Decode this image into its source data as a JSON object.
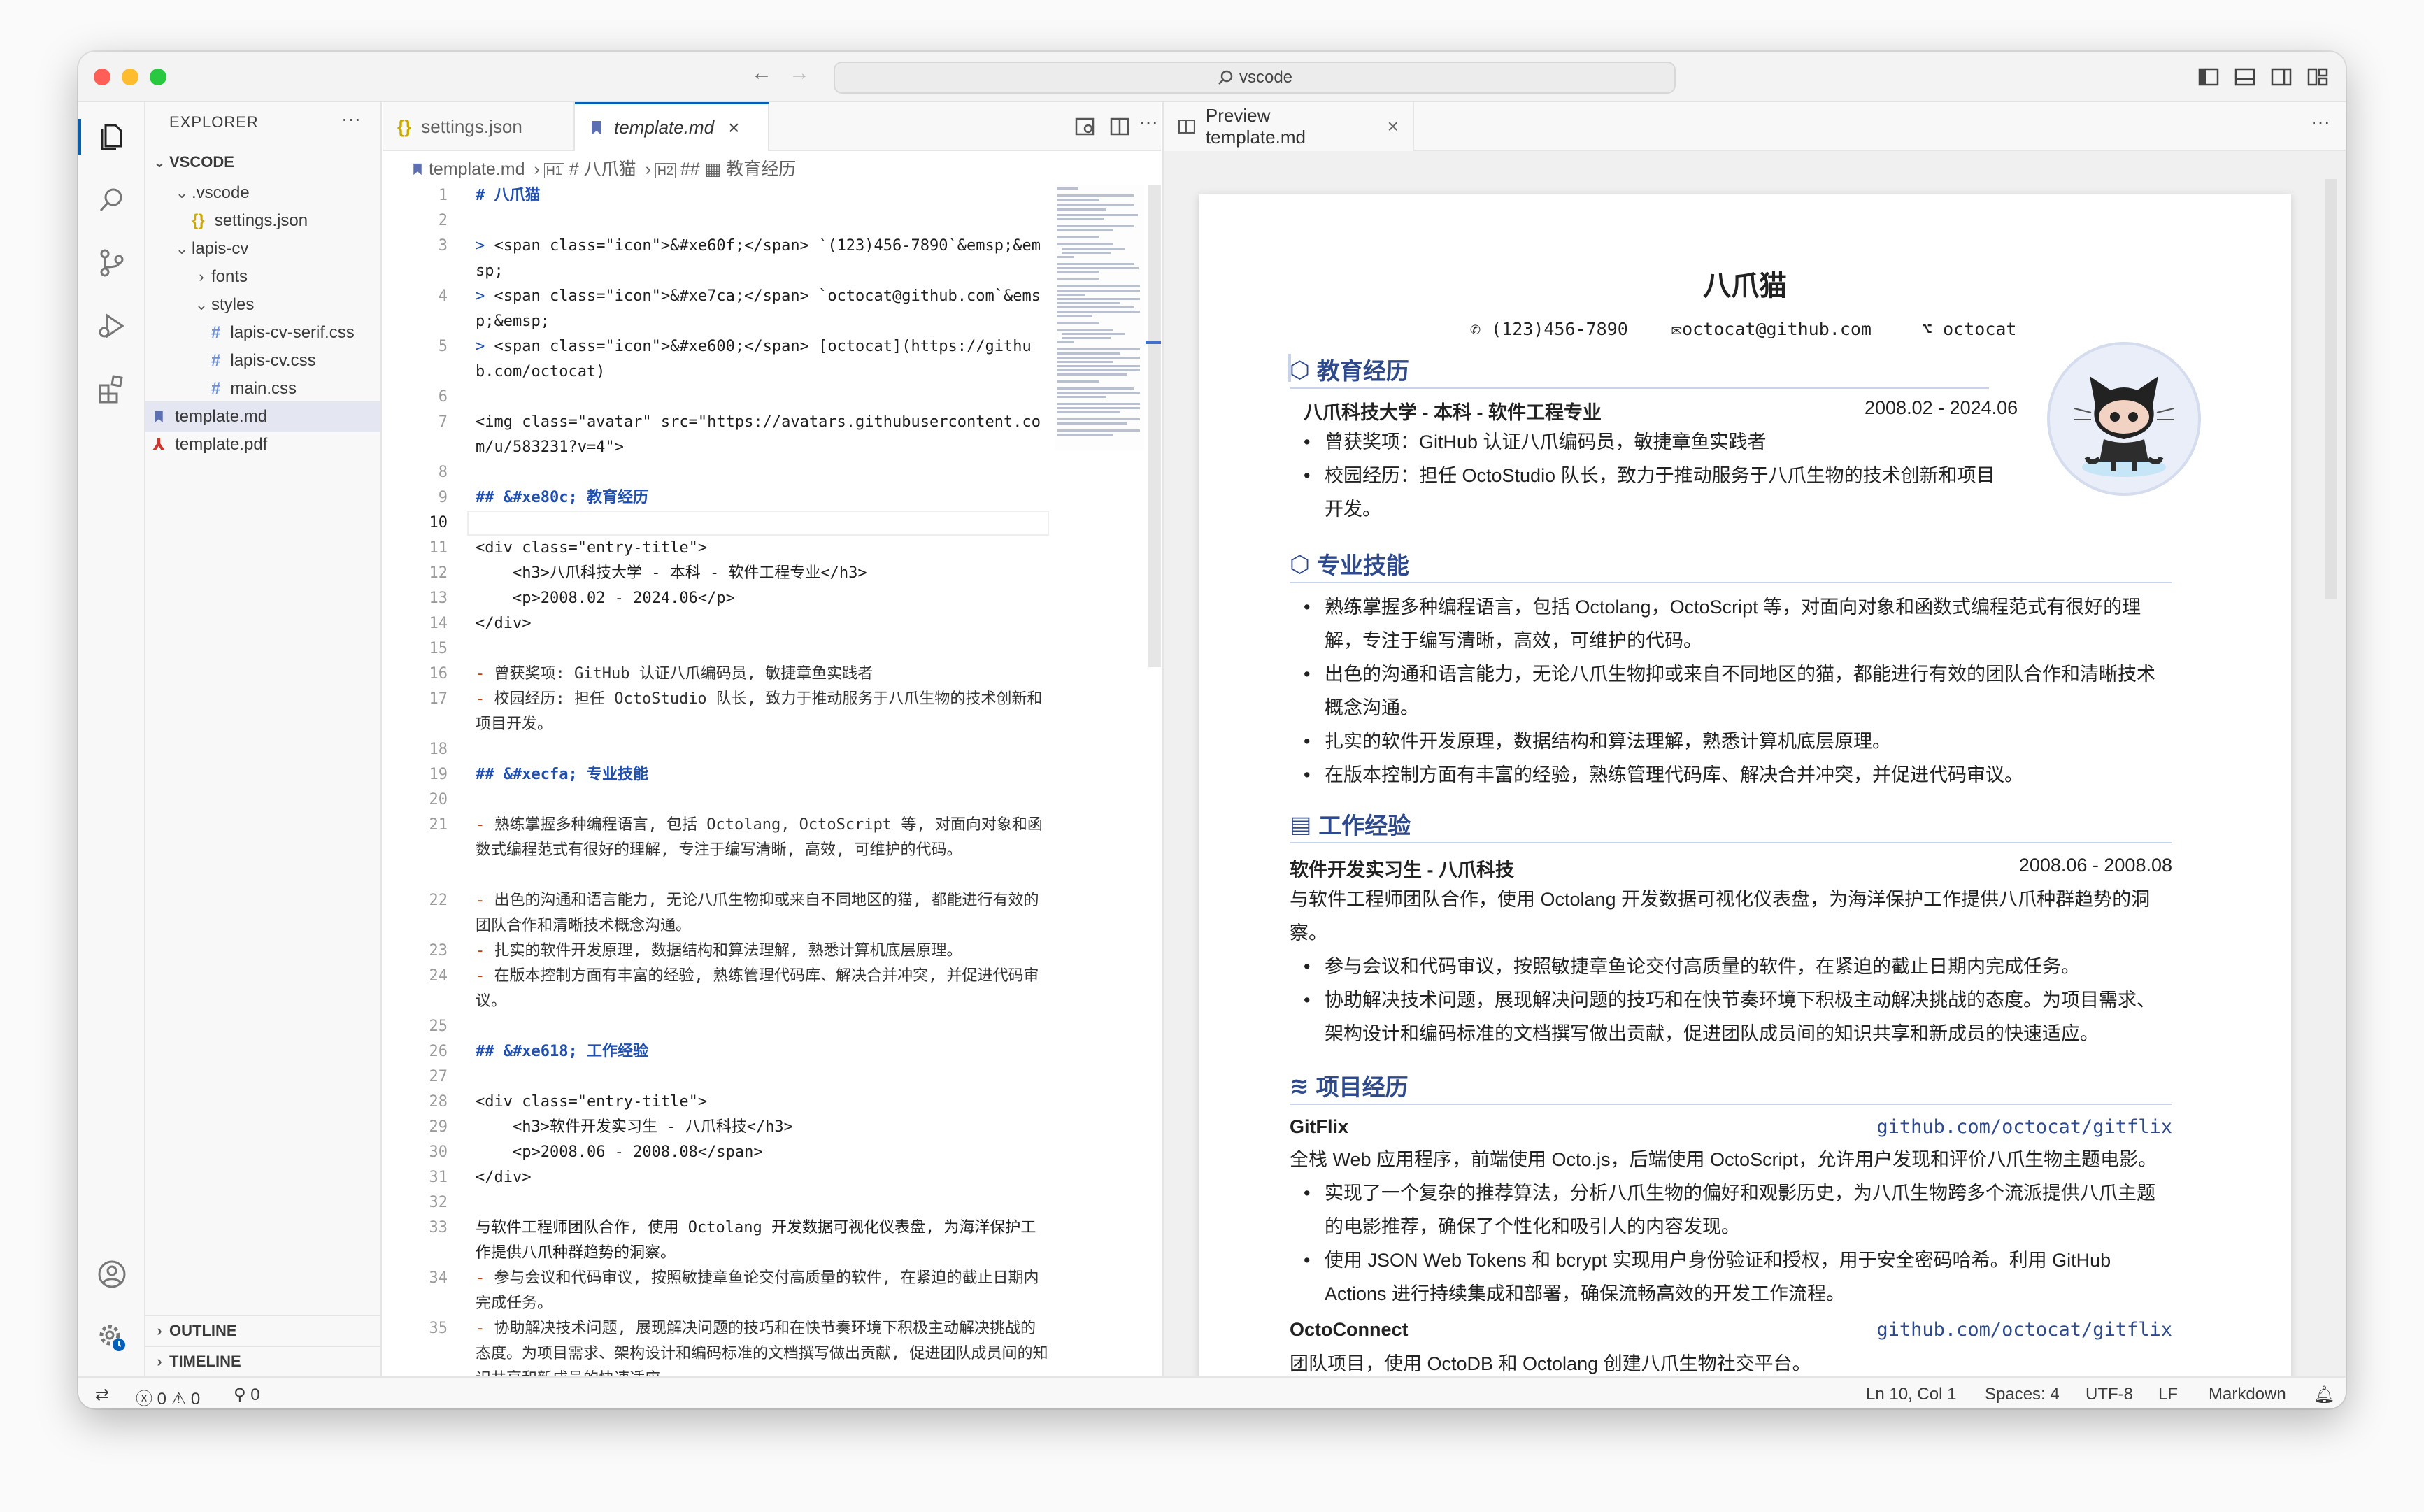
{
  "window": {
    "command_center": "vscode"
  },
  "sidebar": {
    "title": "EXPLORER",
    "root": "VSCODE",
    "tree": [
      {
        "label": ".vscode",
        "kind": "folder-open",
        "depth": 1
      },
      {
        "label": "settings.json",
        "kind": "json",
        "depth": 2
      },
      {
        "label": "lapis-cv",
        "kind": "folder-open",
        "depth": 1
      },
      {
        "label": "fonts",
        "kind": "folder-closed",
        "depth": 2
      },
      {
        "label": "styles",
        "kind": "folder-open",
        "depth": 2
      },
      {
        "label": "lapis-cv-serif.css",
        "kind": "css",
        "depth": 3
      },
      {
        "label": "lapis-cv.css",
        "kind": "css",
        "depth": 3
      },
      {
        "label": "main.css",
        "kind": "css",
        "depth": 3
      },
      {
        "label": "template.md",
        "kind": "md",
        "depth": 0,
        "selected": true
      },
      {
        "label": "template.pdf",
        "kind": "pdf",
        "depth": 0
      }
    ],
    "outline": "OUTLINE",
    "timeline": "TIMELINE"
  },
  "editor": {
    "tabs": [
      {
        "label": "settings.json",
        "active": false
      },
      {
        "label": "template.md",
        "active": true
      }
    ],
    "breadcrumb": {
      "file": "template.md",
      "h1": "# 八爪猫",
      "h2": "## ▦ 教育经历"
    },
    "current_line": 10,
    "lines": [
      {
        "n": "1",
        "text": "# 八爪猫",
        "rows": 1,
        "kind": "heading"
      },
      {
        "n": "2",
        "text": "",
        "rows": 1
      },
      {
        "n": "3",
        "text": "> <span class=\"icon\">&#xe60f;</span> `(123)456-7890`&emsp;&emsp;",
        "rows": 2
      },
      {
        "n": "4",
        "text": "> <span class=\"icon\">&#xe7ca;</span> `octocat@github.com`&emsp;&emsp;",
        "rows": 2
      },
      {
        "n": "5",
        "text": "> <span class=\"icon\">&#xe600;</span> [octocat](https://github.com/octocat)",
        "rows": 2
      },
      {
        "n": "6",
        "text": "",
        "rows": 1
      },
      {
        "n": "7",
        "text": "<img class=\"avatar\" src=\"https://avatars.githubusercontent.com/u/583231?v=4\">",
        "rows": 2
      },
      {
        "n": "8",
        "text": "",
        "rows": 1
      },
      {
        "n": "9",
        "text": "## &#xe80c; 教育经历",
        "rows": 1,
        "kind": "heading"
      },
      {
        "n": "10",
        "text": "",
        "rows": 1
      },
      {
        "n": "11",
        "text": "<div class=\"entry-title\">",
        "rows": 1
      },
      {
        "n": "12",
        "text": "    <h3>八爪科技大学 - 本科 - 软件工程专业</h3>",
        "rows": 1
      },
      {
        "n": "13",
        "text": "    <p>2008.02 - 2024.06</p>",
        "rows": 1
      },
      {
        "n": "14",
        "text": "</div>",
        "rows": 1
      },
      {
        "n": "15",
        "text": "",
        "rows": 1
      },
      {
        "n": "16",
        "text": "- 曾获奖项: GitHub 认证八爪编码员, 敏捷章鱼实践者",
        "rows": 1
      },
      {
        "n": "17",
        "text": "- 校园经历: 担任 OctoStudio 队长, 致力于推动服务于八爪生物的技术创新和项目开发。",
        "rows": 2
      },
      {
        "n": "18",
        "text": "",
        "rows": 1
      },
      {
        "n": "19",
        "text": "## &#xecfa; 专业技能",
        "rows": 1,
        "kind": "heading"
      },
      {
        "n": "20",
        "text": "",
        "rows": 1
      },
      {
        "n": "21",
        "text": "- 熟练掌握多种编程语言, 包括 Octolang, OctoScript 等, 对面向对象和函数式编程范式有很好的理解, 专注于编写清晰, 高效, 可维护的代码。",
        "rows": 3
      },
      {
        "n": "22",
        "text": "- 出色的沟通和语言能力, 无论八爪生物抑或来自不同地区的猫, 都能进行有效的团队合作和清晰技术概念沟通。",
        "rows": 2
      },
      {
        "n": "23",
        "text": "- 扎实的软件开发原理, 数据结构和算法理解, 熟悉计算机底层原理。",
        "rows": 1
      },
      {
        "n": "24",
        "text": "- 在版本控制方面有丰富的经验, 熟练管理代码库、解决合并冲突, 并促进代码审议。",
        "rows": 2
      },
      {
        "n": "25",
        "text": "",
        "rows": 1
      },
      {
        "n": "26",
        "text": "## &#xe618; 工作经验",
        "rows": 1,
        "kind": "heading"
      },
      {
        "n": "27",
        "text": "",
        "rows": 1
      },
      {
        "n": "28",
        "text": "<div class=\"entry-title\">",
        "rows": 1
      },
      {
        "n": "29",
        "text": "    <h3>软件开发实习生 - 八爪科技</h3>",
        "rows": 1
      },
      {
        "n": "30",
        "text": "    <p>2008.06 - 2008.08</span>",
        "rows": 1
      },
      {
        "n": "31",
        "text": "</div>",
        "rows": 1
      },
      {
        "n": "32",
        "text": "",
        "rows": 1
      },
      {
        "n": "33",
        "text": "与软件工程师团队合作, 使用 Octolang 开发数据可视化仪表盘, 为海洋保护工作提供八爪种群趋势的洞察。",
        "rows": 2
      },
      {
        "n": "34",
        "text": "- 参与会议和代码审议, 按照敏捷章鱼论交付高质量的软件, 在紧迫的截止日期内完成任务。",
        "rows": 2
      },
      {
        "n": "35",
        "text": "- 协助解决技术问题, 展现解决问题的技巧和在快节奏环境下积极主动解决挑战的态度。为项目需求、架构设计和编码标准的文档撰写做出贡献, 促进团队成员间的知识共享和新成员的快速适应。",
        "rows": 3
      }
    ]
  },
  "preview": {
    "tab_label": "Preview template.md",
    "name": "八爪猫",
    "phone": "(123)456-7890",
    "email": "octocat@github.com",
    "github": "octocat",
    "education": {
      "title": "教育经历",
      "entry": "八爪科技大学 - 本科 - 软件工程专业",
      "dates": "2008.02 - 2024.06",
      "bullets": [
        "曾获奖项：GitHub 认证八爪编码员，敏捷章鱼实践者",
        "校园经历：担任 OctoStudio 队长，致力于推动服务于八爪生物的技术创新和项目开发。"
      ]
    },
    "skills": {
      "title": "专业技能",
      "bullets": [
        "熟练掌握多种编程语言，包括 Octolang，OctoScript 等，对面向对象和函数式编程范式有很好的理解，专注于编写清晰，高效，可维护的代码。",
        "出色的沟通和语言能力，无论八爪生物抑或来自不同地区的猫，都能进行有效的团队合作和清晰技术概念沟通。",
        "扎实的软件开发原理，数据结构和算法理解，熟悉计算机底层原理。",
        "在版本控制方面有丰富的经验，熟练管理代码库、解决合并冲突，并促进代码审议。"
      ]
    },
    "work": {
      "title": "工作经验",
      "entry": "软件开发实习生 - 八爪科技",
      "dates": "2008.06 - 2008.08",
      "summary": "与软件工程师团队合作，使用 Octolang 开发数据可视化仪表盘，为海洋保护工作提供八爪种群趋势的洞察。",
      "bullets": [
        "参与会议和代码审议，按照敏捷章鱼论交付高质量的软件，在紧迫的截止日期内完成任务。",
        "协助解决技术问题，展现解决问题的技巧和在快节奏环境下积极主动解决挑战的态度。为项目需求、架构设计和编码标准的文档撰写做出贡献，促进团队成员间的知识共享和新成员的快速适应。"
      ]
    },
    "projects": {
      "title": "项目经历",
      "p1_name": "GitFlix",
      "p1_link": "github.com/octocat/gitflix",
      "p1_summary": "全栈 Web 应用程序，前端使用 Octo.js，后端使用 OctoScript，允许用户发现和评价八爪生物主题电影。",
      "p1_bullets": [
        "实现了一个复杂的推荐算法，分析八爪生物的偏好和观影历史，为八爪生物跨多个流派提供八爪主题的电影推荐，确保了个性化和吸引人的内容发现。",
        "使用 JSON Web Tokens 和 bcrypt 实现用户身份验证和授权，用于安全密码哈希。利用 GitHub Actions 进行持续集成和部署，确保流畅高效的开发工作流程。"
      ],
      "p2_name": "OctoConnect",
      "p2_link": "github.com/octocat/gitflix",
      "p2_summary": "团队项目，使用 OctoDB 和 Octolang 创建八爪生物社交平台。"
    }
  },
  "status": {
    "errors": "0",
    "warnings": "0",
    "ports": "0",
    "position": "Ln 10, Col 1",
    "spaces": "Spaces: 4",
    "encoding": "UTF-8",
    "eol": "LF",
    "language": "Markdown"
  }
}
